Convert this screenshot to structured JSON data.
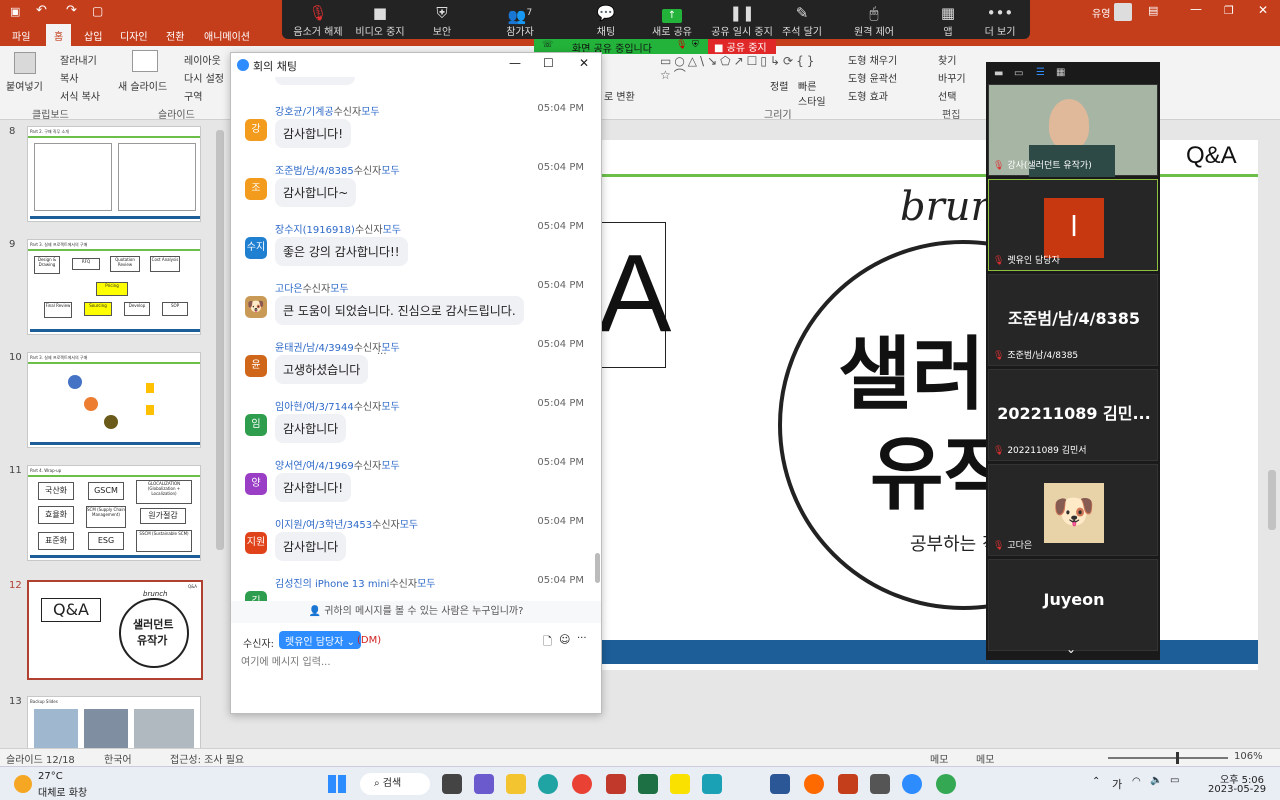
{
  "ppt": {
    "user": "유영",
    "tabs": [
      "파일",
      "홈",
      "삽입",
      "디자인",
      "전환",
      "애니메이션"
    ],
    "active_tab": "홈",
    "ribbon": {
      "paste": "붙여넣기",
      "cut": "잘라내기",
      "copy": "복사",
      "format_painter": "서식 복사",
      "clipboard": "클립보드",
      "new_slide": "새 슬라이드",
      "layout": "레이아웃",
      "reset": "다시 설정",
      "section": "구역",
      "slides": "슬라이드",
      "shape_fill": "도형 채우기",
      "shape_outline": "도형 윤곽선",
      "shape_effects": "도형 효과",
      "arrange": "정렬",
      "quick_styles": "빠른 스타일",
      "drawing": "그리기",
      "find": "찾기",
      "replace": "바꾸기",
      "select": "선택",
      "editing": "편집",
      "convert": "로 변환"
    },
    "slides": [
      {
        "num": "8",
        "title": "Part 2. 구매 직무 소개"
      },
      {
        "num": "9",
        "title": "Part 3. 실제 프로젝트에서의 구매"
      },
      {
        "num": "10",
        "title": "Part 3. 실제 프로젝트에서의 구매"
      },
      {
        "num": "11",
        "title": "Part 4. Wrap-up"
      },
      {
        "num": "12",
        "title": "Q&A"
      },
      {
        "num": "13",
        "title": "Backup Slides"
      }
    ],
    "thumb9_boxes": [
      "Design & Drawing",
      "RFQ",
      "Quotation Review",
      "Cost Analysis",
      "Pricing",
      "Final Review",
      "Sourcing",
      "Develop",
      "SOP"
    ],
    "thumb11_boxes": [
      "국산화",
      "GSCM",
      "GLOCALIZATION (Globalization + Localization)",
      "효율화",
      "SCM (Supply Chain Management)",
      "원가절감",
      "표준화",
      "ESG",
      "SSCM (Sustainable SCM)"
    ],
    "thumb12": {
      "qa": "Q&A",
      "brand": "brunch",
      "logo1": "샐러던트",
      "logo2": "유작가"
    },
    "slide": {
      "qa_big": "A",
      "qa_corner": "Q&A",
      "brand": "brun",
      "logo1": "샐러",
      "logo2": "유작",
      "sub": "공부하는 직"
    },
    "status": {
      "slide_count": "슬라이드 12/18",
      "lang": "한국어",
      "access": "접근성: 조사 필요",
      "notes": "메모",
      "notes2": "메모",
      "zoom": "106%"
    }
  },
  "zoom": {
    "toolbar": [
      {
        "label": "음소거 해제",
        "icon": "mic-off-icon"
      },
      {
        "label": "비디오 중지",
        "icon": "video-icon"
      },
      {
        "label": "보안",
        "icon": "shield-icon"
      },
      {
        "label": "참가자",
        "icon": "participants-icon",
        "count": "7"
      },
      {
        "label": "채팅",
        "icon": "chat-icon"
      },
      {
        "label": "새로 공유",
        "icon": "share-icon"
      },
      {
        "label": "공유 일시 중지",
        "icon": "pause-icon"
      },
      {
        "label": "주석 달기",
        "icon": "annotate-icon"
      },
      {
        "label": "원격 제어",
        "icon": "mouse-icon"
      },
      {
        "label": "앱",
        "icon": "apps-icon"
      },
      {
        "label": "더 보기",
        "icon": "more-icon"
      }
    ],
    "share_banner": "화면 공유 중입니다",
    "stop_share": "공유 중지",
    "gallery": [
      {
        "name": "강사(샐러던트 유작가)",
        "type": "video"
      },
      {
        "name": "렛유인 담당자",
        "type": "initial",
        "initial": "l"
      },
      {
        "name": "조준범/남/4/8385",
        "type": "text",
        "big": "조준범/남/4/8385"
      },
      {
        "name": "202211089 김민서",
        "type": "text",
        "big": "202211089 김민..."
      },
      {
        "name": "고다은",
        "type": "dog"
      },
      {
        "name": "Juyeon",
        "type": "text",
        "big": "Juyeon"
      }
    ]
  },
  "chat": {
    "title": "회의 채팅",
    "messages": [
      {
        "sender": "강호균/기계공",
        "to": "수신자",
        "target": "모두",
        "time": "05:04 PM",
        "text": "감사합니다!",
        "avatar": "강",
        "color": "#f29b1c"
      },
      {
        "sender": "조준범/남/4/8385",
        "to": "수신자",
        "target": "모두",
        "time": "05:04 PM",
        "text": "감사합니다~",
        "avatar": "조",
        "color": "#f29b1c"
      },
      {
        "sender": "장수지(1916918)",
        "to": "수신자",
        "target": "모두",
        "time": "05:04 PM",
        "text": "좋은 강의 감사합니다!!",
        "avatar": "수지",
        "color": "#1f7fd1"
      },
      {
        "sender": "고다은",
        "to": "수신자",
        "target": "모두",
        "time": "05:04 PM",
        "text": "큰 도움이 되었습니다. 진심으로 감사드립니다.",
        "avatar": "",
        "color": "#c99a56"
      },
      {
        "sender": "윤태권/남/4/3949",
        "to": "수신자",
        "target": "모두",
        "time": "05:04 PM",
        "text": "고생하셨습니다",
        "avatar": "윤",
        "color": "#d0661a"
      },
      {
        "sender": "임아현/여/3/7144",
        "to": "수신자",
        "target": "모두",
        "time": "05:04 PM",
        "text": "감사합니다",
        "avatar": "임",
        "color": "#2e9e4e"
      },
      {
        "sender": "양서연/여/4/1969",
        "to": "수신자",
        "target": "모두",
        "time": "05:04 PM",
        "text": "감사합니다!",
        "avatar": "양",
        "color": "#9a3ec6"
      },
      {
        "sender": "이지원/여/3학년/3453",
        "to": "수신자",
        "target": "모두",
        "time": "05:04 PM",
        "text": "감사합니다",
        "avatar": "지원",
        "color": "#e0421a"
      },
      {
        "sender": "김성진의 iPhone 13 mini",
        "to": "수신자",
        "target": "모두",
        "time": "05:04 PM",
        "text": "",
        "avatar": "김",
        "color": "#2e9e4e"
      }
    ],
    "who_can_see": "귀하의 메시지를 볼 수 있는 사람은 누구입니까?",
    "recipient_label": "수신자:",
    "recipient": "렛유인 담당자",
    "dm": "(DM)",
    "input_placeholder": "여기에 메시지 입력..."
  },
  "taskbar": {
    "weather_temp": "27°C",
    "weather_desc": "대체로 화창",
    "search": "검색",
    "time": "오후 5:06",
    "date": "2023-05-29",
    "ime": "가"
  }
}
